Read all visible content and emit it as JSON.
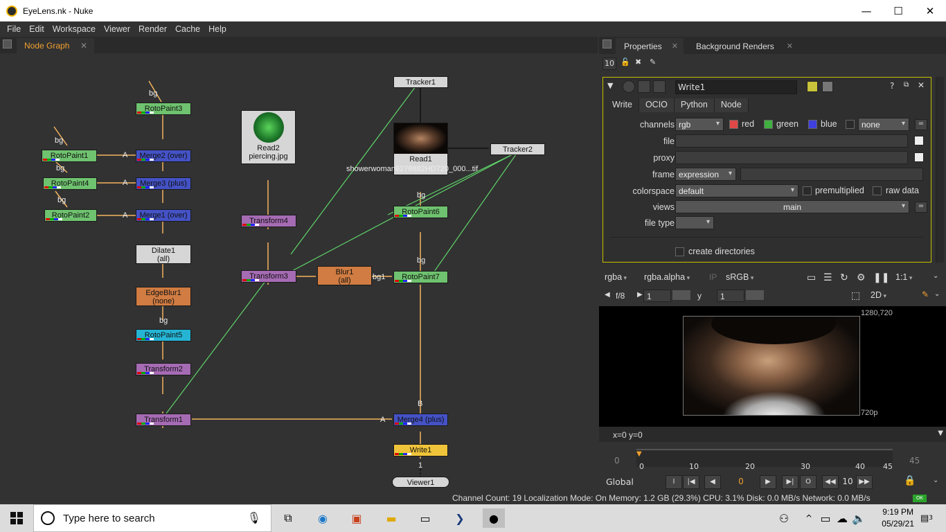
{
  "window": {
    "title": "EyeLens.nk - Nuke"
  },
  "menu": [
    "File",
    "Edit",
    "Workspace",
    "Viewer",
    "Render",
    "Cache",
    "Help"
  ],
  "node_graph": {
    "tab": "Node Graph",
    "nodes": {
      "rotopaint3": "RotoPaint3",
      "rotopaint1": "RotoPaint1",
      "rotopaint4": "RotoPaint4",
      "rotopaint2": "RotoPaint2",
      "merge2": "Merge2 (over)",
      "merge3": "Merge3 (plus)",
      "merge1": "Merge1 (over)",
      "dilate1": "Dilate1",
      "dilate1_sub": "(all)",
      "edgeblur1": "EdgeBlur1",
      "edgeblur1_sub": "(none)",
      "rotopaint5": "RotoPaint5",
      "transform2": "Transform2",
      "transform1": "Transform1",
      "read2": "Read2",
      "read2_file": "piercing.jpg",
      "transform4": "Transform4",
      "transform3": "Transform3",
      "blur1": "Blur1",
      "blur1_sub": "(all)",
      "tracker1": "Tracker1",
      "read1": "Read1",
      "read1_file": "showerwoman6278882HD720_000...tif",
      "tracker2": "Tracker2",
      "rotopaint6": "RotoPaint6",
      "rotopaint7": "RotoPaint7",
      "merge4": "Merge4 (plus)",
      "write1": "Write1",
      "viewer1": "Viewer1"
    },
    "labels": {
      "bg": "bg",
      "a": "A",
      "b": "B",
      "bg1": "bg1",
      "one": "1"
    }
  },
  "properties": {
    "tabs": [
      "Properties",
      "Background Renders"
    ],
    "max_panels": "10",
    "node_name": "Write1",
    "subtabs": [
      "Write",
      "OCIO",
      "Python",
      "Node"
    ],
    "channels_label": "channels",
    "channels_value": "rgb",
    "red": "red",
    "green": "green",
    "blue": "blue",
    "alpha_value": "none",
    "file_label": "file",
    "proxy_label": "proxy",
    "frame_label": "frame",
    "frame_value": "expression",
    "colorspace_label": "colorspace",
    "colorspace_value": "default",
    "premultiplied": "premultiplied",
    "raw_data": "raw data",
    "views_label": "views",
    "views_value": "main",
    "filetype_label": "file type",
    "create_dirs": "create directories"
  },
  "viewer": {
    "channels": "rgba",
    "alpha": "rgba.alpha",
    "ip": "IP",
    "lut": "sRGB",
    "zoom": "1:1",
    "fstop": "f/8",
    "gain": "1",
    "gamma_label": "y",
    "gamma": "1",
    "mode": "2D",
    "res_top": "1280,720",
    "res_bottom": "720p",
    "readout": "x=0 y=0",
    "timeline": {
      "start": "0",
      "end": "45",
      "current": "0",
      "ticks": [
        "0",
        "10",
        "20",
        "30",
        "40",
        "45"
      ]
    },
    "transport": {
      "range": "Global",
      "frame": "0",
      "step": "10",
      "in": "I",
      "out": "O"
    }
  },
  "status": "Channel Count: 19  Localization Mode: On  Memory: 1.2 GB (29.3%)  CPU: 3.1%  Disk: 0.0 MB/s  Network: 0.0 MB/s",
  "status_ok": "OK",
  "taskbar": {
    "search_placeholder": "Type here to search",
    "time": "9:19 PM",
    "date": "05/29/21",
    "notif": "3"
  }
}
